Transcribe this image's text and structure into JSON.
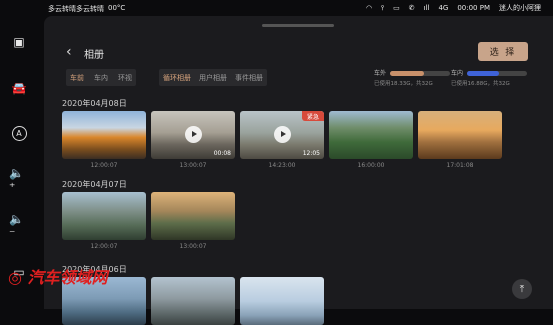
{
  "status": {
    "weather_left": "多云转晴多云转晴",
    "temp": "00°C",
    "network": "4G",
    "time": "00:00 PM",
    "user": "迷人的小阿狸"
  },
  "header": {
    "title": "相册",
    "select_label": "选 择"
  },
  "camera_tabs": [
    {
      "label": "车前",
      "active": true
    },
    {
      "label": "车内",
      "active": false
    },
    {
      "label": "环视",
      "active": false
    }
  ],
  "album_tabs": [
    {
      "label": "循环相册",
      "active": true
    },
    {
      "label": "用户相册",
      "active": false
    },
    {
      "label": "事件相册",
      "active": false
    }
  ],
  "storage": [
    {
      "name": "车外",
      "usage": "已使用18.33G，共32G",
      "fraction": 0.57,
      "color": "#c8906a"
    },
    {
      "name": "车内",
      "usage": "已使用16.88G，共32G",
      "fraction": 0.53,
      "color": "#3f63d8"
    }
  ],
  "groups": [
    {
      "date": "2020年04月08日",
      "items": [
        {
          "type": "photo",
          "caption": "12:00:07",
          "scene": "autumn"
        },
        {
          "type": "video",
          "caption": "13:00:07",
          "duration": "00:08",
          "scene": "road"
        },
        {
          "type": "video",
          "caption": "14:23:00",
          "duration": "12:05",
          "badge": "紧急",
          "scene": "desert"
        },
        {
          "type": "photo",
          "caption": "16:00:00",
          "scene": "forest"
        },
        {
          "type": "photo",
          "caption": "17:01:08",
          "scene": "sunset"
        }
      ]
    },
    {
      "date": "2020年04月07日",
      "items": [
        {
          "type": "photo",
          "caption": "12:00:07",
          "scene": "mountain"
        },
        {
          "type": "photo",
          "caption": "13:00:07",
          "scene": "highway"
        }
      ]
    },
    {
      "date": "2020年04月06日",
      "items": [
        {
          "type": "photo",
          "caption": "",
          "scene": "lake"
        },
        {
          "type": "photo",
          "caption": "",
          "scene": "peaks"
        },
        {
          "type": "photo",
          "caption": "",
          "scene": "sky"
        }
      ]
    }
  ],
  "watermark": "汽车领域网",
  "icons": [
    "screen-icon",
    "car-icon",
    "auto-drive-icon",
    "volume-up-icon",
    "volume-down-icon",
    "cast-icon",
    "back-to-top-icon"
  ]
}
